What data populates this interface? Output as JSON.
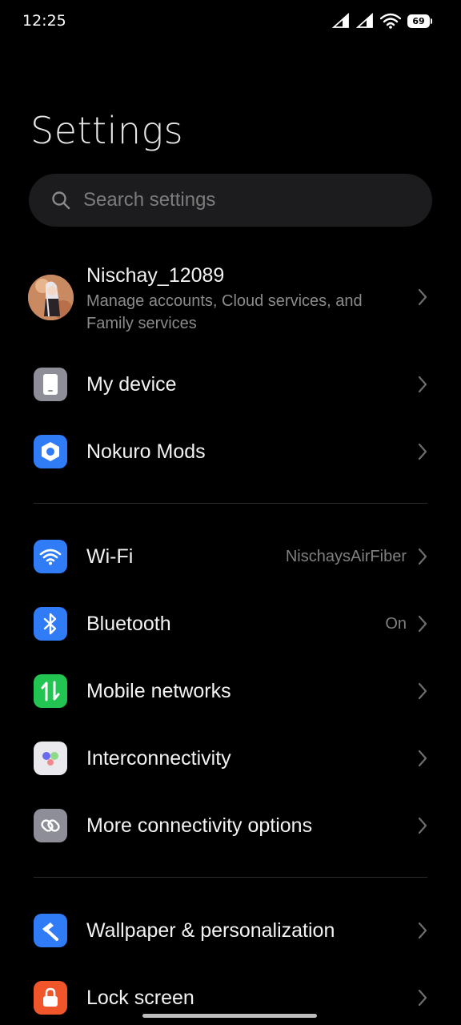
{
  "status_bar": {
    "time": "12:25",
    "battery": "69",
    "icons": [
      "signal-icon",
      "signal-icon",
      "wifi-icon",
      "battery-icon"
    ]
  },
  "header": {
    "title": "Settings"
  },
  "search": {
    "placeholder": "Search settings"
  },
  "account": {
    "name": "Nischay_12089",
    "subtitle": "Manage accounts, Cloud services, and Family services"
  },
  "section1": [
    {
      "label": "My device",
      "icon": "phone-icon",
      "color": "#8e8e99"
    },
    {
      "label": "Nokuro Mods",
      "icon": "hexagon-icon",
      "color": "#2f7cf6"
    }
  ],
  "section2": [
    {
      "label": "Wi-Fi",
      "value": "NischaysAirFiber",
      "icon": "wifi-icon",
      "color": "#2f7cf6"
    },
    {
      "label": "Bluetooth",
      "value": "On",
      "icon": "bluetooth-icon",
      "color": "#2f7cf6"
    },
    {
      "label": "Mobile networks",
      "value": "",
      "icon": "mobile-data-icon",
      "color": "#23c552"
    },
    {
      "label": "Interconnectivity",
      "value": "",
      "icon": "interconnectivity-icon",
      "color": "#e9e9ee"
    },
    {
      "label": "More connectivity options",
      "value": "",
      "icon": "link-icon",
      "color": "#8e8e99"
    }
  ],
  "section3": [
    {
      "label": "Wallpaper & personalization",
      "icon": "brush-icon",
      "color": "#2f7cf6"
    },
    {
      "label": "Lock screen",
      "icon": "lock-icon",
      "color": "#f0562a"
    }
  ]
}
